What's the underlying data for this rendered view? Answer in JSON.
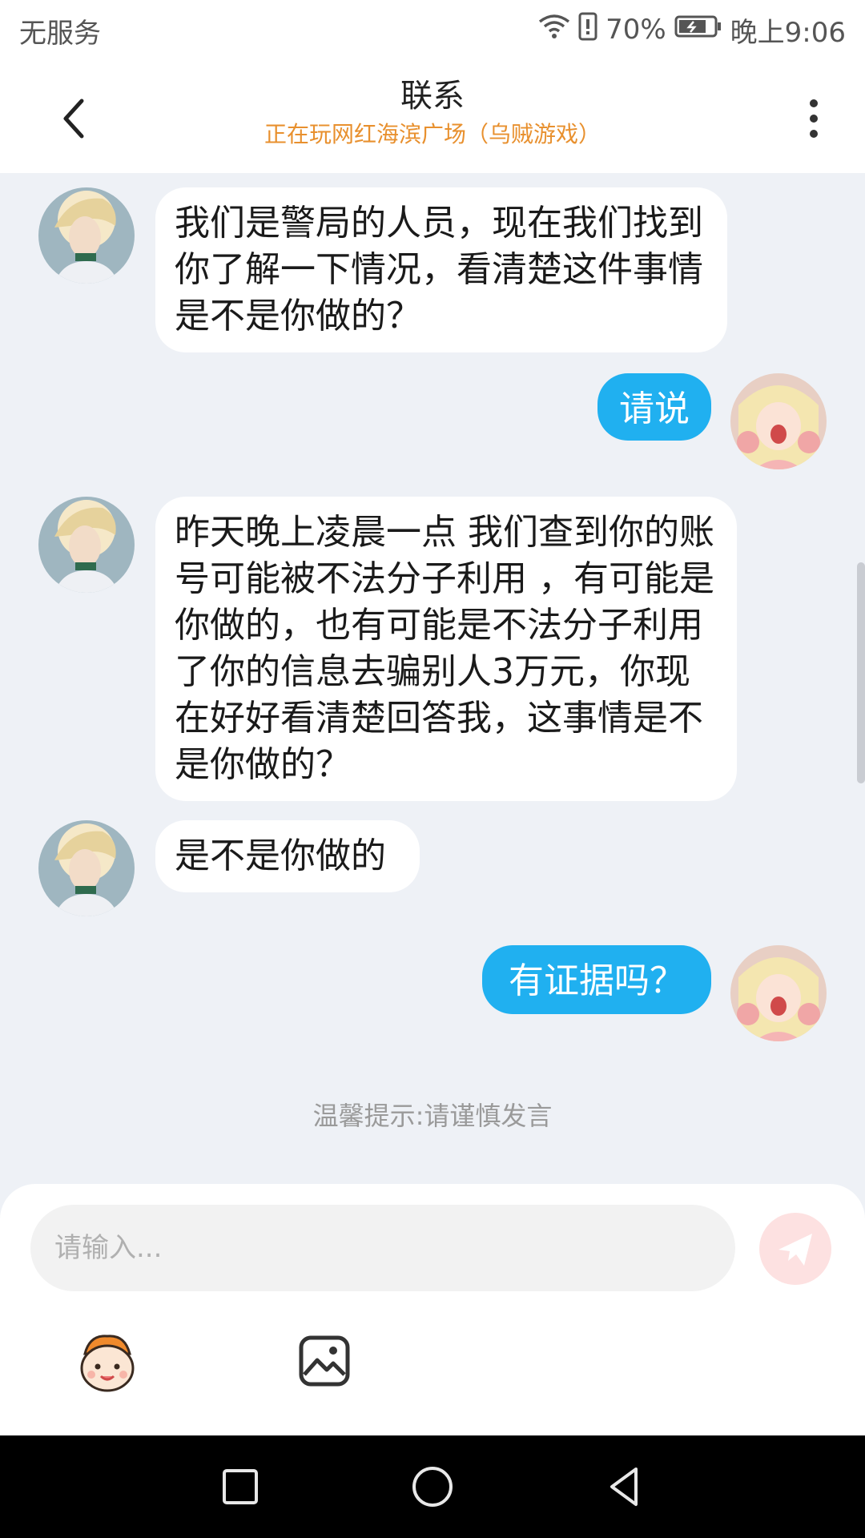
{
  "status": {
    "carrier": "无服务",
    "battery_pct": "70%",
    "time": "晚上9:06"
  },
  "header": {
    "title": "联系",
    "subtitle": "正在玩网红海滨广场（乌贼游戏）"
  },
  "messages": [
    {
      "side": "in",
      "text": "我们是警局的人员，现在我们找到你了解一下情况，看清楚这件事情是不是你做的？"
    },
    {
      "side": "out",
      "text": "请说"
    },
    {
      "side": "in",
      "text": "昨天晚上凌晨一点 我们查到你的账号可能被不法分子利用 ，有可能是你做的，也有可能是不法分子利用了你的信息去骗别人3万元，你现在好好看清楚回答我，这事情是不是你做的？"
    },
    {
      "side": "in",
      "text": "是不是你做的"
    },
    {
      "side": "out",
      "text": "有证据吗？"
    }
  ],
  "tip": "温馨提示:请谨慎发言",
  "composer": {
    "placeholder": "请输入..."
  },
  "icons": {
    "back": "chevron-left-icon",
    "more": "more-vertical-icon",
    "send": "paper-plane-icon",
    "emoji": "emoji-face-icon",
    "image": "image-icon"
  },
  "colors": {
    "outgoing_bubble": "#20b0f0",
    "subtitle": "#e8902e",
    "background": "#eef1f6"
  }
}
